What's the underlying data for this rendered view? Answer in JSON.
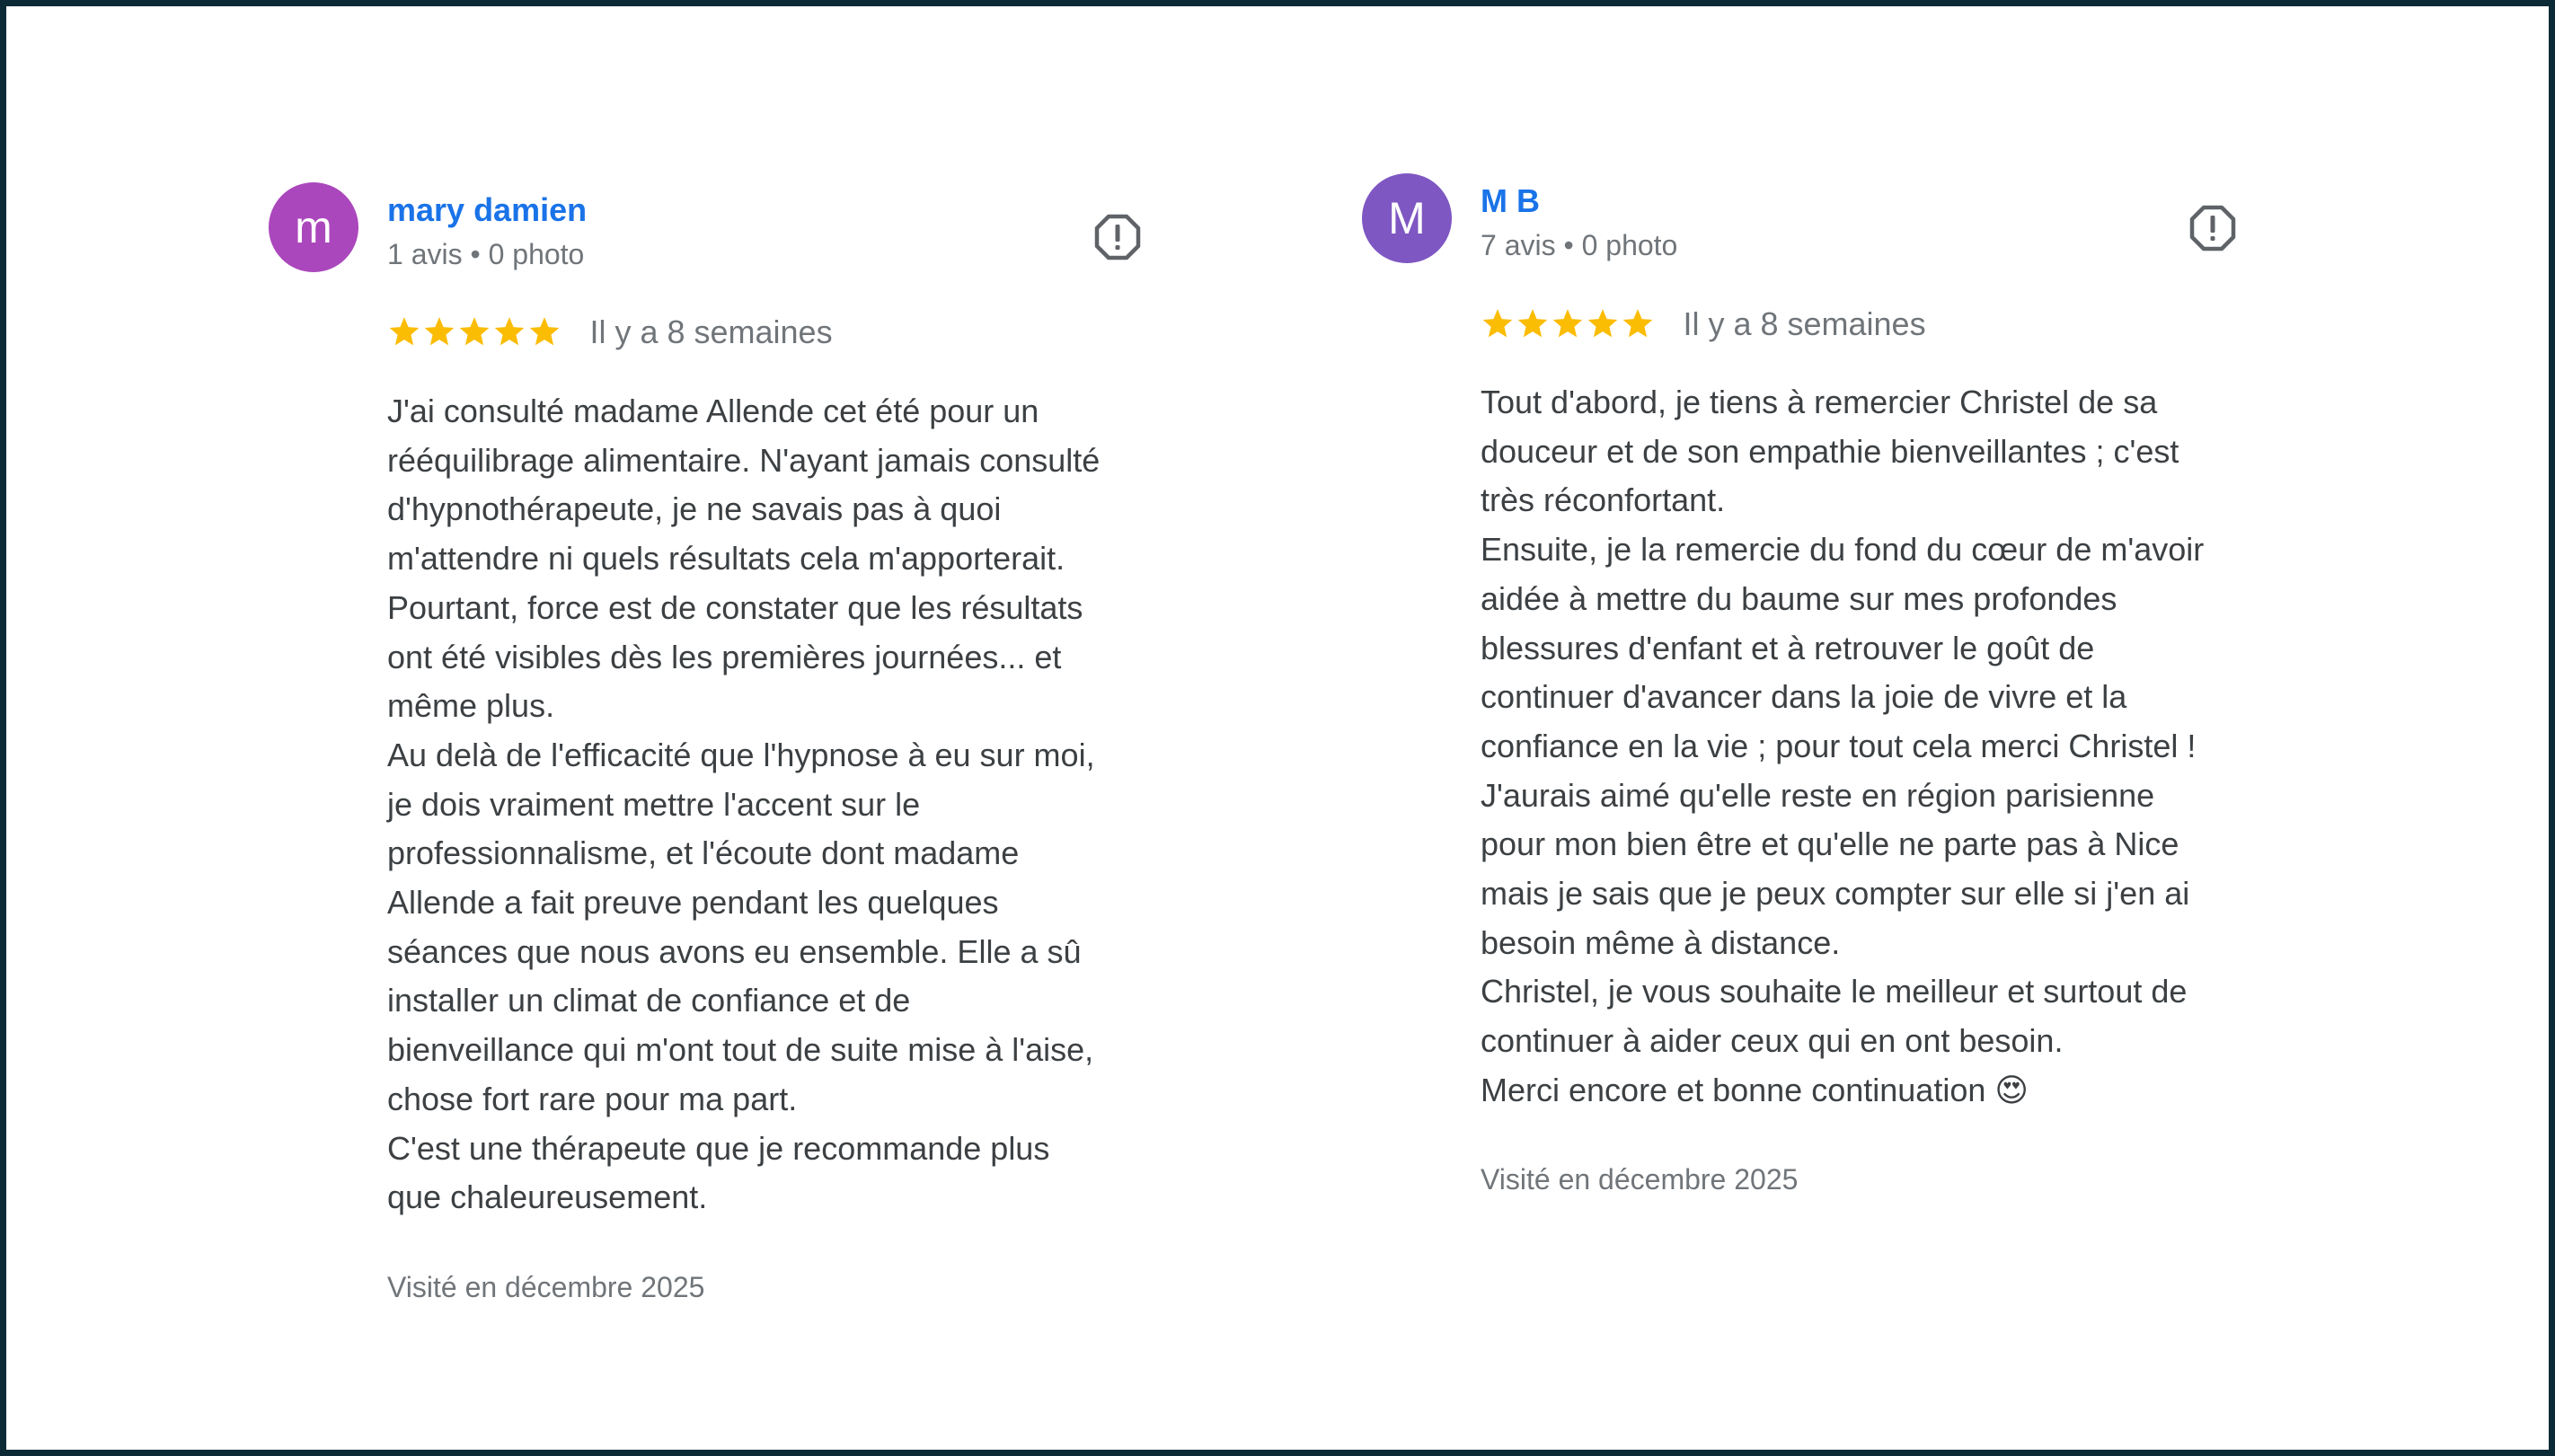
{
  "colors": {
    "frame_bg": "#0b2a36",
    "card_bg": "#ffffff",
    "name_link": "#1a73e8",
    "star": "#fbbc04",
    "muted_text": "#70757a",
    "body_text": "#3c4043",
    "avatar_1": "#ab47bc",
    "avatar_2": "#7e57c2"
  },
  "reviews": [
    {
      "avatar_letter": "m",
      "name": "mary damien",
      "meta": "1 avis • 0 photo",
      "report_icon": "report-flag-icon",
      "rating": 5,
      "date": "Il y a 8 semaines",
      "lines": [
        "J'ai consulté madame Allende cet été pour un",
        "rééquilibrage alimentaire. N'ayant jamais consulté",
        "d'hypnothérapeute, je ne savais pas à quoi",
        "m'attendre ni quels résultats cela m'apporterait.",
        "Pourtant, force est de constater que les résultats",
        "ont été visibles dès les premières journées... et",
        "même plus.",
        "Au delà de l'efficacité que l'hypnose à eu sur moi,",
        "je dois vraiment mettre l'accent sur le",
        "professionnalisme, et l'écoute dont madame",
        "Allende a fait preuve pendant les quelques",
        "séances que nous avons eu ensemble. Elle a sû",
        "installer un climat de confiance et de",
        "bienveillance qui m'ont tout de suite mise à l'aise,",
        "chose fort rare pour ma part.",
        "C'est une thérapeute que je recommande plus",
        "que chaleureusement."
      ],
      "visited": "Visité en décembre 2025"
    },
    {
      "avatar_letter": "M",
      "name": "M B",
      "meta": "7 avis • 0 photo",
      "report_icon": "report-flag-icon",
      "rating": 5,
      "date": "Il y a 8 semaines",
      "lines": [
        "Tout d'abord, je tiens à remercier Christel de sa",
        "douceur et de son empathie bienveillantes ; c'est",
        "très réconfortant.",
        "Ensuite, je la remercie du fond du cœur de m'avoir",
        "aidée à mettre du baume sur mes profondes",
        "blessures d'enfant et à retrouver le goût de",
        "continuer d'avancer dans la joie de vivre et la",
        "confiance en la vie ; pour tout cela merci Christel !",
        "J'aurais aimé qu'elle reste en région parisienne",
        "pour mon bien être et qu'elle ne parte pas à Nice",
        "mais je sais que je peux compter sur elle si j'en ai",
        "besoin même à distance.",
        "Christel, je vous souhaite le meilleur et surtout de",
        "continuer à aider ceux qui en ont besoin.",
        "Merci encore et bonne continuation 😍"
      ],
      "visited": "Visité en décembre 2025"
    }
  ]
}
